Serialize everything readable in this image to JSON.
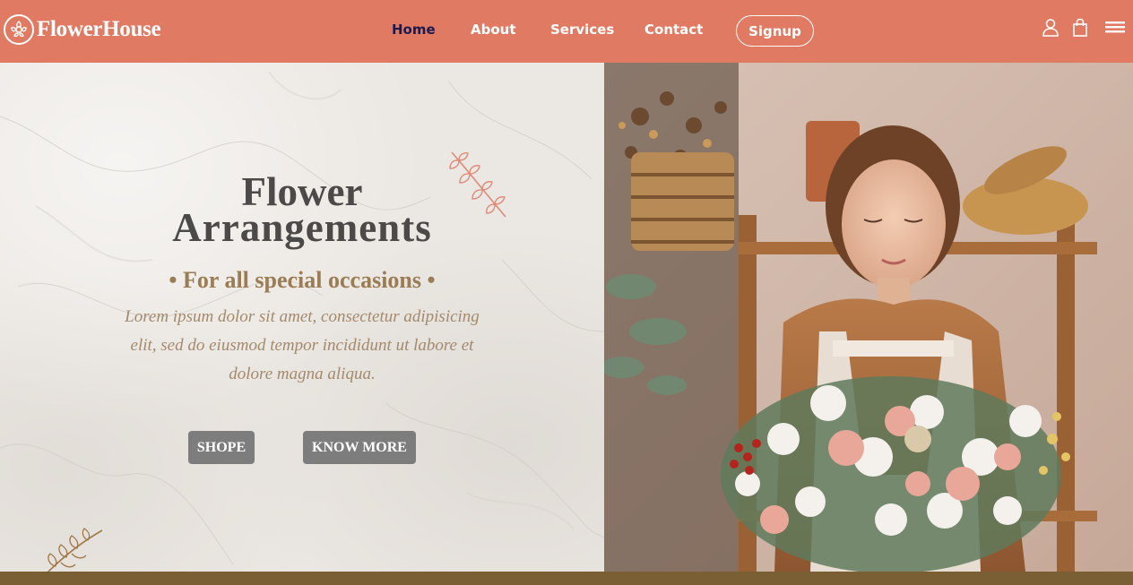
{
  "brand": {
    "name": "FlowerHouse"
  },
  "nav": {
    "items": [
      {
        "label": "Home",
        "active": true
      },
      {
        "label": "About",
        "active": false
      },
      {
        "label": "Services",
        "active": false
      },
      {
        "label": "Contact",
        "active": false
      }
    ],
    "signup_label": "Signup"
  },
  "header_icons": [
    "user-icon",
    "shopping-bag-icon",
    "menu-icon"
  ],
  "hero": {
    "title_line1": "Flower",
    "title_line2": "Arrangements",
    "subtitle": "• For all special occasions •",
    "description": "Lorem ipsum dolor sit amet, consectetur adipisicing elit, sed do eiusmod tempor incididunt ut labore et dolore magna aliqua.",
    "primary_button": "SHOPE",
    "secondary_button": "KNOW MORE"
  },
  "colors": {
    "header_bg": "#e07a63",
    "active_nav": "#1c1a4e",
    "hero_bg": "#ebe7e2",
    "title": "#4b4a48",
    "subtitle": "#9a7c55",
    "button_bg": "#7d7d7d",
    "footer_bar": "#7a5e34"
  }
}
